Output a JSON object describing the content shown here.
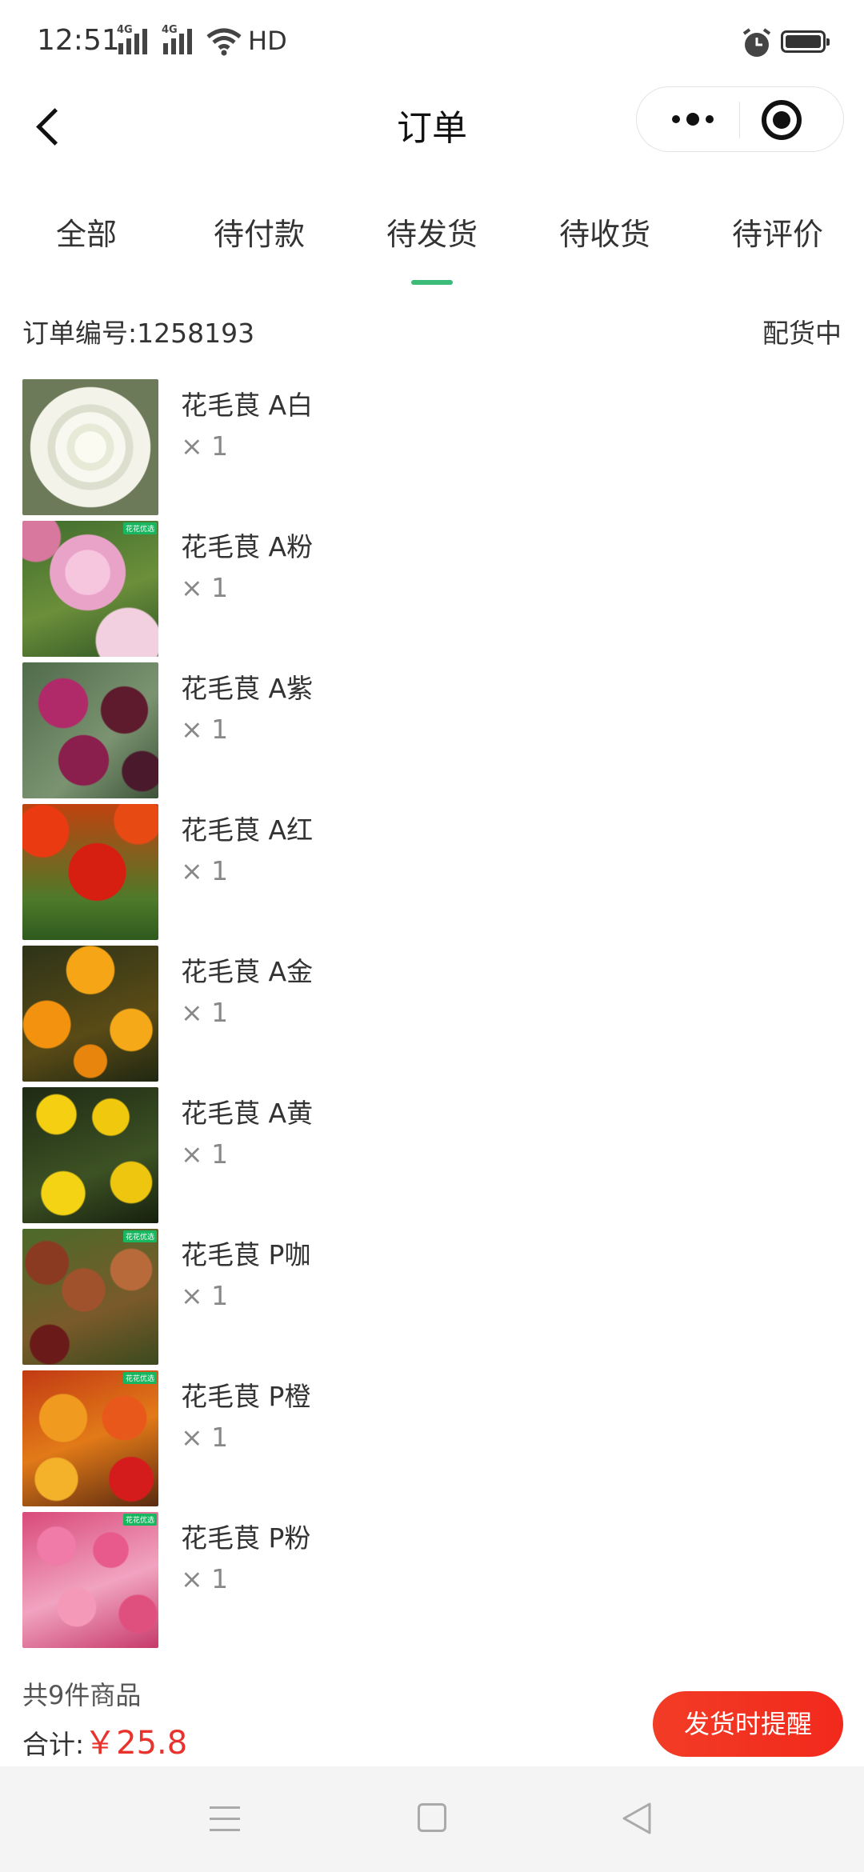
{
  "status_bar": {
    "time": "12:51",
    "signal_label": "4G",
    "network": "HD"
  },
  "header": {
    "title": "订单",
    "back_icon": "chevron-left-icon",
    "more_icon": "more-dots-icon",
    "close_icon": "target-circle-icon"
  },
  "tabs": [
    {
      "label": "全部",
      "active": false
    },
    {
      "label": "待付款",
      "active": false
    },
    {
      "label": "待发货",
      "active": true
    },
    {
      "label": "待收货",
      "active": false
    },
    {
      "label": "待评价",
      "active": false
    }
  ],
  "order": {
    "number_label": "订单编号:1258193",
    "status": "配货中",
    "items": [
      {
        "name": "花毛茛 A白",
        "qty": "× 1"
      },
      {
        "name": "花毛茛 A粉",
        "qty": "× 1",
        "badge": "花花优选"
      },
      {
        "name": "花毛茛 A紫",
        "qty": "× 1"
      },
      {
        "name": "花毛茛 A红",
        "qty": "× 1"
      },
      {
        "name": "花毛茛 A金",
        "qty": "× 1"
      },
      {
        "name": "花毛茛 A黄",
        "qty": "× 1"
      },
      {
        "name": "花毛茛 P咖",
        "qty": "× 1",
        "badge": "花花优选"
      },
      {
        "name": "花毛茛 P橙",
        "qty": "× 1",
        "badge": "花花优选"
      },
      {
        "name": "花毛茛 P粉",
        "qty": "× 1",
        "badge": "花花优选"
      }
    ],
    "count_label": "共9件商品",
    "total_label": "合计:",
    "total_price": "￥25.8",
    "remind_button": "发货时提醒"
  },
  "colors": {
    "accent_green": "#3dbb78",
    "price_red": "#e8322c",
    "button_red": "#f2291c"
  }
}
